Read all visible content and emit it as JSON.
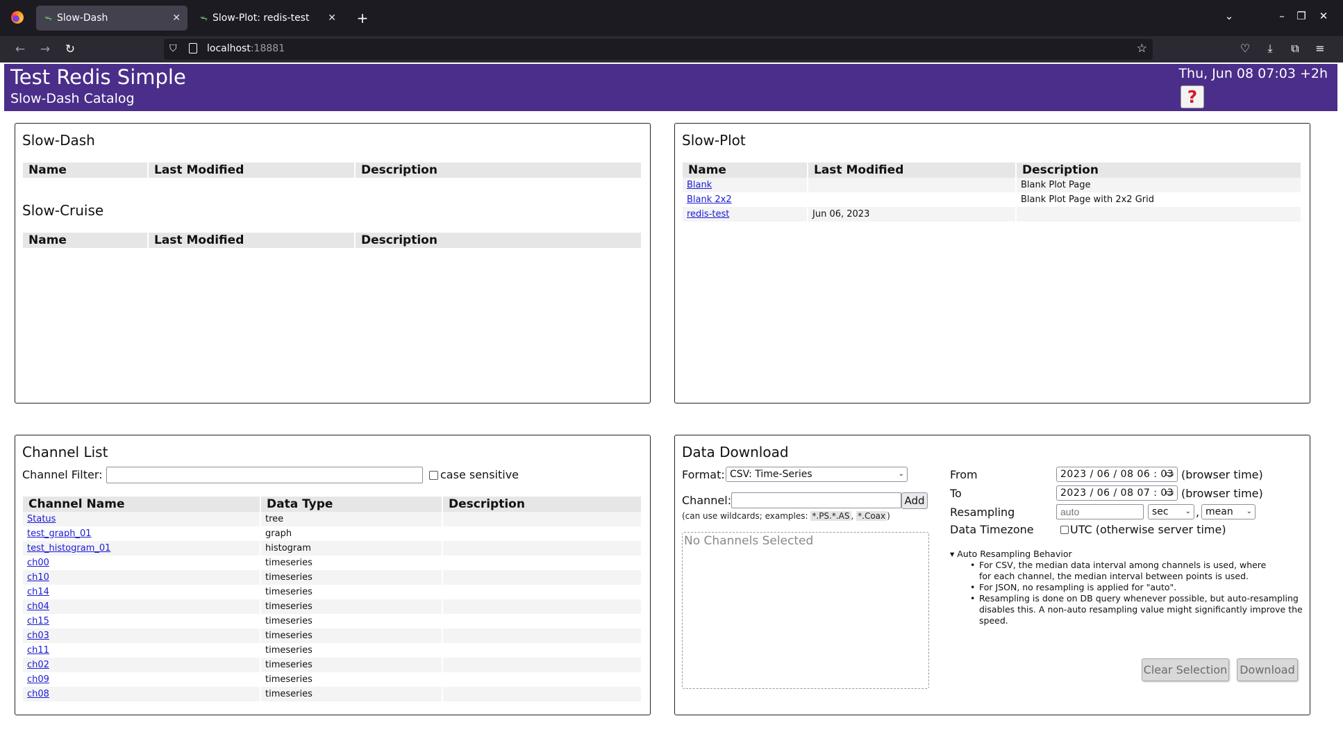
{
  "browser": {
    "tabs": [
      {
        "title": "Slow-Dash",
        "active": true
      },
      {
        "title": "Slow-Plot: redis-test",
        "active": false
      }
    ],
    "url_host": "localhost",
    "url_port": ":18881"
  },
  "header": {
    "title": "Test Redis Simple",
    "subtitle": "Slow-Dash Catalog",
    "clock": "Thu, Jun 08 07:03 +2h",
    "help": "?"
  },
  "slowdash": {
    "title": "Slow-Dash",
    "columns": [
      "Name",
      "Last Modified",
      "Description"
    ],
    "rows": []
  },
  "slowcruise": {
    "title": "Slow-Cruise",
    "columns": [
      "Name",
      "Last Modified",
      "Description"
    ],
    "rows": []
  },
  "slowplot": {
    "title": "Slow-Plot",
    "columns": [
      "Name",
      "Last Modified",
      "Description"
    ],
    "rows": [
      {
        "name": "Blank",
        "modified": "",
        "description": "Blank Plot Page"
      },
      {
        "name": "Blank 2x2",
        "modified": "",
        "description": "Blank Plot Page with 2x2 Grid"
      },
      {
        "name": "redis-test",
        "modified": "Jun 06, 2023",
        "description": ""
      }
    ]
  },
  "channel_list": {
    "title": "Channel List",
    "filter_label": "Channel Filter:",
    "filter_value": "",
    "case_sensitive_label": "case sensitive",
    "columns": [
      "Channel Name",
      "Data Type",
      "Description"
    ],
    "rows": [
      {
        "name": "Status",
        "type": "tree",
        "description": ""
      },
      {
        "name": "test_graph_01",
        "type": "graph",
        "description": ""
      },
      {
        "name": "test_histogram_01",
        "type": "histogram",
        "description": ""
      },
      {
        "name": "ch00",
        "type": "timeseries",
        "description": ""
      },
      {
        "name": "ch10",
        "type": "timeseries",
        "description": ""
      },
      {
        "name": "ch14",
        "type": "timeseries",
        "description": ""
      },
      {
        "name": "ch04",
        "type": "timeseries",
        "description": ""
      },
      {
        "name": "ch15",
        "type": "timeseries",
        "description": ""
      },
      {
        "name": "ch03",
        "type": "timeseries",
        "description": ""
      },
      {
        "name": "ch11",
        "type": "timeseries",
        "description": ""
      },
      {
        "name": "ch02",
        "type": "timeseries",
        "description": ""
      },
      {
        "name": "ch09",
        "type": "timeseries",
        "description": ""
      },
      {
        "name": "ch08",
        "type": "timeseries",
        "description": ""
      }
    ]
  },
  "download": {
    "title": "Data Download",
    "format_label": "Format:",
    "format_value": "CSV: Time-Series",
    "channel_label": "Channel:",
    "channel_value": "",
    "add_label": "Add",
    "wildcard_prefix": "(can use wildcards; examples: ",
    "wildcard_ex1": "*.PS.*.AS",
    "wildcard_sep": ", ",
    "wildcard_ex2": "*.Coax",
    "wildcard_suffix": ")",
    "no_channels": "No Channels Selected",
    "from_label": "From",
    "from_value": "2023 / 06 / 08   06 : 03",
    "to_label": "To",
    "to_value": "2023 / 06 / 08   07 : 03",
    "browser_time": "(browser time)",
    "resampling_label": "Resampling",
    "resampling_placeholder": "auto",
    "resampling_unit": "sec",
    "resampling_comma": ",",
    "resampling_method": "mean",
    "timezone_label": "Data Timezone",
    "utc_label": "UTC (otherwise server time)",
    "auto_title": "Auto Resampling Behavior",
    "auto_notes": [
      [
        "For CSV, the median data interval among channels is used, where",
        "for each channel, the median interval between points is used."
      ],
      [
        "For JSON, no resampling is applied for \"auto\"."
      ],
      [
        "Resampling is done on DB query whenever possible, but auto-resampling",
        "disables this. A non-auto resampling value might significantly improve the",
        "speed."
      ]
    ],
    "clear_label": "Clear Selection",
    "download_label": "Download"
  }
}
